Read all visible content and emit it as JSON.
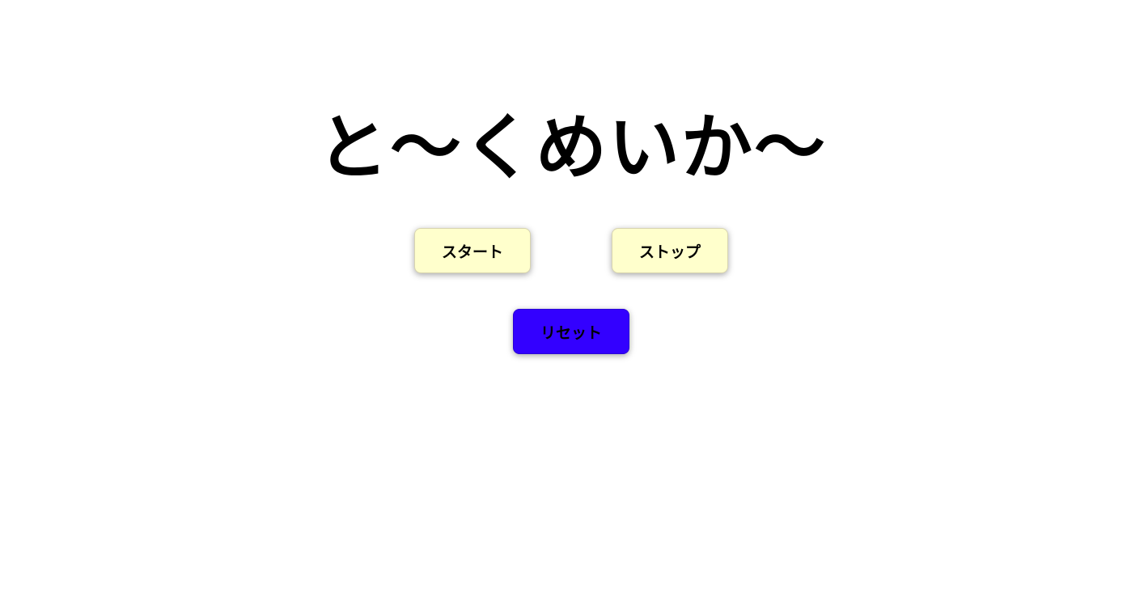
{
  "title": "と〜くめいか〜",
  "buttons": {
    "start_label": "スタート",
    "stop_label": "ストップ",
    "reset_label": "リセット"
  },
  "colors": {
    "background": "#ffffff",
    "start_button": "#ffffcc",
    "stop_button": "#ffffcc",
    "reset_button": "#3300ff",
    "text": "#000000"
  }
}
